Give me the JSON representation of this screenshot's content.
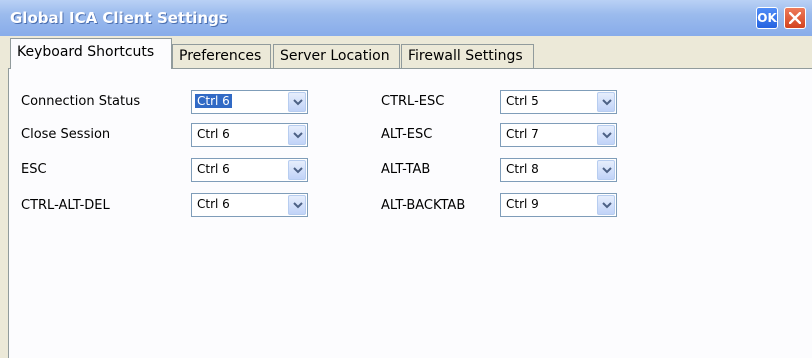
{
  "window": {
    "title": "Global ICA Client Settings",
    "ok_label": "OK"
  },
  "tabs": [
    {
      "label": "Keyboard Shortcuts",
      "active": true
    },
    {
      "label": "Preferences"
    },
    {
      "label": "Server Location"
    },
    {
      "label": "Firewall Settings"
    }
  ],
  "shortcuts": {
    "left": [
      {
        "label": "Connection Status",
        "value": "Ctrl 6",
        "selected": true
      },
      {
        "label": "Close Session",
        "value": "Ctrl 6"
      },
      {
        "label": "ESC",
        "value": "Ctrl 6"
      },
      {
        "label": "CTRL-ALT-DEL",
        "value": "Ctrl 6"
      }
    ],
    "right": [
      {
        "label": "CTRL-ESC",
        "value": "Ctrl 5"
      },
      {
        "label": "ALT-ESC",
        "value": "Ctrl 7"
      },
      {
        "label": "ALT-TAB",
        "value": "Ctrl 8"
      },
      {
        "label": "ALT-BACKTAB",
        "value": "Ctrl 9"
      }
    ]
  }
}
